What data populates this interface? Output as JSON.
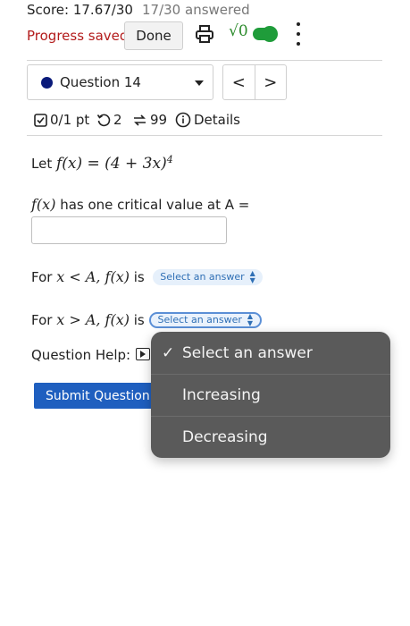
{
  "header": {
    "score": "Score: 17.67/30",
    "answered": "17/30 answered",
    "progress": "Progress saved",
    "done_label": "Done",
    "sqrt_label": "√0",
    "toggle_on": true
  },
  "question_nav": {
    "selected": "Question 14",
    "prev": "<",
    "next": ">",
    "dot_color": "#0a1a7a"
  },
  "meta": {
    "points": "0/1 pt",
    "retries": "2",
    "attempts": "99",
    "details": "Details"
  },
  "problem": {
    "let_text": "Let",
    "function_expr": "f(x) = (4 + 3x)",
    "exponent": "4",
    "critical_func": "f(x)",
    "critical_text": "has one critical value at A =",
    "answer_value": "",
    "for_label": "For",
    "less_cond": "x < A, f(x)",
    "greater_cond": "x > A, f(x)",
    "is_label": "is",
    "select_placeholder_1": "Select an answer",
    "select_placeholder_2": "Select an answer"
  },
  "help": {
    "label": "Question Help:"
  },
  "submit_label": "Submit Question",
  "dropdown": {
    "checkmark": "✓",
    "options": [
      "Select an answer",
      "Increasing",
      "Decreasing"
    ],
    "selected_index": 0
  },
  "colors": {
    "progress": "#b31b1b",
    "toggle": "#1f9c3a",
    "submit": "#1f5fbf",
    "select_text": "#2f6fb5",
    "dropdown_bg": "#5a5a5a"
  }
}
